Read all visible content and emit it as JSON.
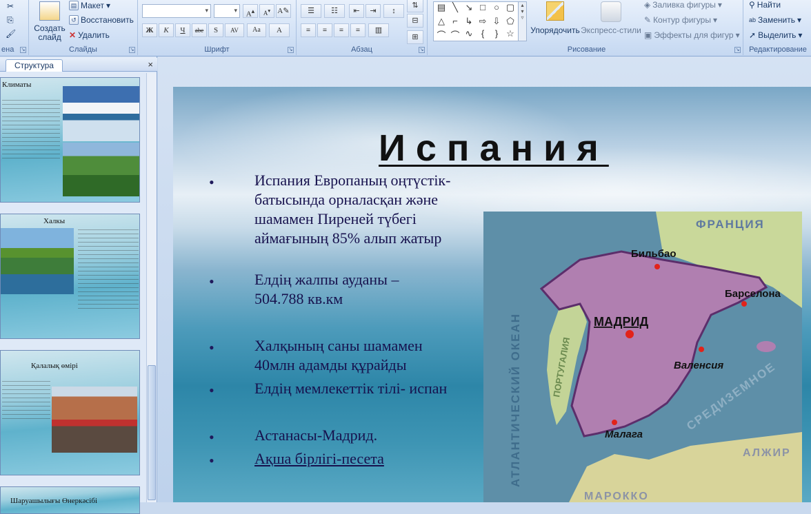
{
  "ribbon": {
    "slides_group": {
      "label": "Слайды",
      "create_slide": "Создать слайд",
      "layout": "Макет",
      "reset": "Восстановить",
      "delete": "Удалить"
    },
    "clipboard_group": {
      "label": "Буфер обмена",
      "visible_fragment": "ена"
    },
    "font_group": {
      "label": "Шрифт",
      "buttons": [
        "Ж",
        "К",
        "Ч",
        "abe",
        "S",
        "AV",
        "Aa",
        "A"
      ]
    },
    "paragraph_group": {
      "label": "Абзац"
    },
    "drawing_group": {
      "label": "Рисование",
      "arrange": "Упорядочить",
      "quick_styles": "Экспресс-стили",
      "shape_fill": "Заливка фигуры",
      "shape_outline": "Контур фигуры",
      "shape_effects": "Эффекты для фигур"
    },
    "editing_group": {
      "label": "Редактирование",
      "find": "Найти",
      "replace": "Заменить",
      "select": "Выделить"
    }
  },
  "panel": {
    "tab_outline": "Структура",
    "close": "×",
    "thumbnails": [
      {
        "title": "Климаты"
      },
      {
        "title": "Халкы"
      },
      {
        "title": "Қалалық өмірі"
      },
      {
        "title": "Шаруашылығы Өнеркәсібі"
      }
    ]
  },
  "slide": {
    "title": "Испания",
    "bullets": [
      "Испания Европаның оңтүстік- батысында орналасқан және шамамен Пиреней түбегі аймағының 85% алып жатыр",
      "Елдің жалпы ауданы – 504.788 кв.км",
      "Халқының саны шамамен 40млн  адамды құрайды",
      "Елдің мемлекеттік тілі- испан",
      "Астанасы-Мадрид.",
      "Ақша бірлігі-песета"
    ],
    "bullet_symbol": "•",
    "map": {
      "labels": {
        "france": "ФРАНЦИЯ",
        "ocean": "АТЛАНТИЧЕСКИЙ  ОКЕАН",
        "bilbao": "Бильбао",
        "barcelona": "Барселона",
        "madrid": "МАДРИД",
        "valencia": "Валенсия",
        "malaga": "Малага",
        "portugal": "ПОРТУГАЛИЯ",
        "mediterranean": "СРЕДИЗЕМНОЕ",
        "algeria": "АЛЖИР",
        "morocco": "МАРОККО"
      }
    }
  },
  "colors": {
    "bullet_text": "#17124e",
    "title": "#111111",
    "spain": "#b07fb0"
  }
}
